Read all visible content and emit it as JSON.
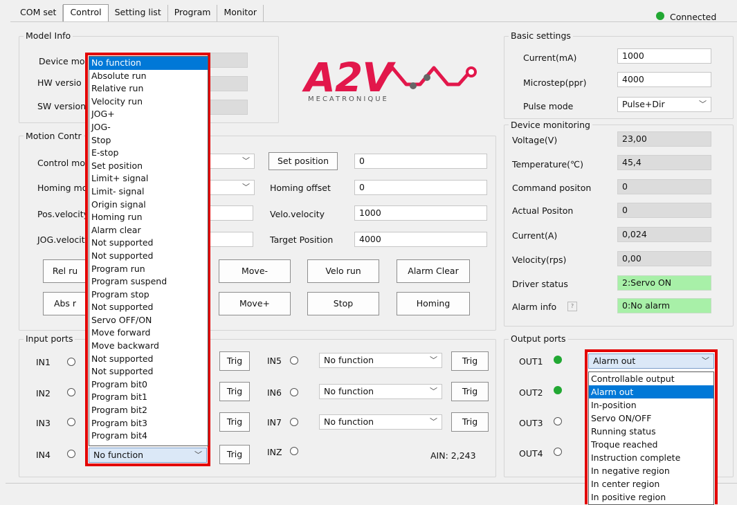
{
  "tabs": [
    {
      "label": "COM set"
    },
    {
      "label": "Control"
    },
    {
      "label": "Setting list"
    },
    {
      "label": "Program"
    },
    {
      "label": "Monitor"
    }
  ],
  "connection": {
    "status": "Connected",
    "color": "#22a833"
  },
  "model_info": {
    "title": "Model Info",
    "device_label": "Device mo",
    "hw_label": "HW versio",
    "sw_label": "SW version"
  },
  "logo": {
    "main": "A2V",
    "sub": "MECATRONIQUE",
    "color": "#e2174b"
  },
  "motion": {
    "title": "Motion Contr",
    "control_mode_label": "Control mo",
    "homing_mode_label": "Homing mo",
    "pos_velocity_label": "Pos.velocity",
    "jog_velocity_label": "JOG.velocit",
    "set_position_button": "Set position",
    "set_position_value": "0",
    "homing_offset_label": "Homing offset",
    "homing_offset_value": "0",
    "velo_velocity_label": "Velo.velocity",
    "velo_velocity_value": "1000",
    "target_position_label": "Target Position",
    "target_position_value": "4000",
    "buttons": {
      "rel_run": "Rel ru",
      "abs_run": "Abs r",
      "move_minus": "Move-",
      "move_plus": "Move+",
      "velo_run": "Velo run",
      "stop": "Stop",
      "alarm_clear": "Alarm Clear",
      "homing": "Homing"
    }
  },
  "basic": {
    "title": "Basic settings",
    "current_label": "Current(mA)",
    "current_value": "1000",
    "microstep_label": "Microstep(ppr)",
    "microstep_value": "4000",
    "pulse_label": "Pulse mode",
    "pulse_value": "Pulse+Dir"
  },
  "monitoring": {
    "title": "Device monitoring",
    "rows": [
      {
        "label": "Voltage(V)",
        "value": "23,00"
      },
      {
        "label": "Temperature(℃)",
        "value": "45,4"
      },
      {
        "label": "Command positon",
        "value": "0"
      },
      {
        "label": "Actual Positon",
        "value": "0"
      },
      {
        "label": "Current(A)",
        "value": "0,024"
      },
      {
        "label": "Velocity(rps)",
        "value": "0,00"
      },
      {
        "label": "Driver status",
        "value": "2:Servo ON"
      },
      {
        "label": "Alarm info",
        "value": "0:No alarm"
      }
    ]
  },
  "inputs": {
    "title": "Input ports",
    "in1": "IN1",
    "in2": "IN2",
    "in3": "IN3",
    "in4": "IN4",
    "in5": "IN5",
    "in6": "IN6",
    "in7": "IN7",
    "inz": "INZ",
    "in4_func": "No function",
    "in5_func": "No function",
    "in6_func": "No function",
    "in7_func": "No function",
    "trig": "Trig",
    "ain": "AIN: 2,243"
  },
  "outputs": {
    "title": "Output ports",
    "out1": "OUT1",
    "out2": "OUT2",
    "out3": "OUT3",
    "out4": "OUT4",
    "out1_func": "Alarm out"
  },
  "input_dropdown": {
    "options": [
      "No function",
      "Absolute run",
      "Relative run",
      "Velocity run",
      "JOG+",
      "JOG-",
      "Stop",
      "E-stop",
      "Set position",
      "Limit+ signal",
      "Limit- signal",
      "Origin signal",
      "Homing run",
      "Alarm clear",
      "Not supported",
      "Not supported",
      "Program run",
      "Program suspend",
      "Program stop",
      "Not supported",
      "Servo OFF/ON",
      "Move forward",
      "Move backward",
      "Not supported",
      "Not supported",
      "Program bit0",
      "Program bit1",
      "Program bit2",
      "Program bit3",
      "Program bit4"
    ],
    "selected_index": 0,
    "highlight_color": "#e30000"
  },
  "output_dropdown": {
    "options": [
      "Controllable output",
      "Alarm out",
      "In-position",
      "Servo ON/OFF",
      "Running status",
      "Troque reached",
      "Instruction complete",
      "In negative region",
      "In center region",
      "In positive region"
    ],
    "selected_index": 1
  }
}
